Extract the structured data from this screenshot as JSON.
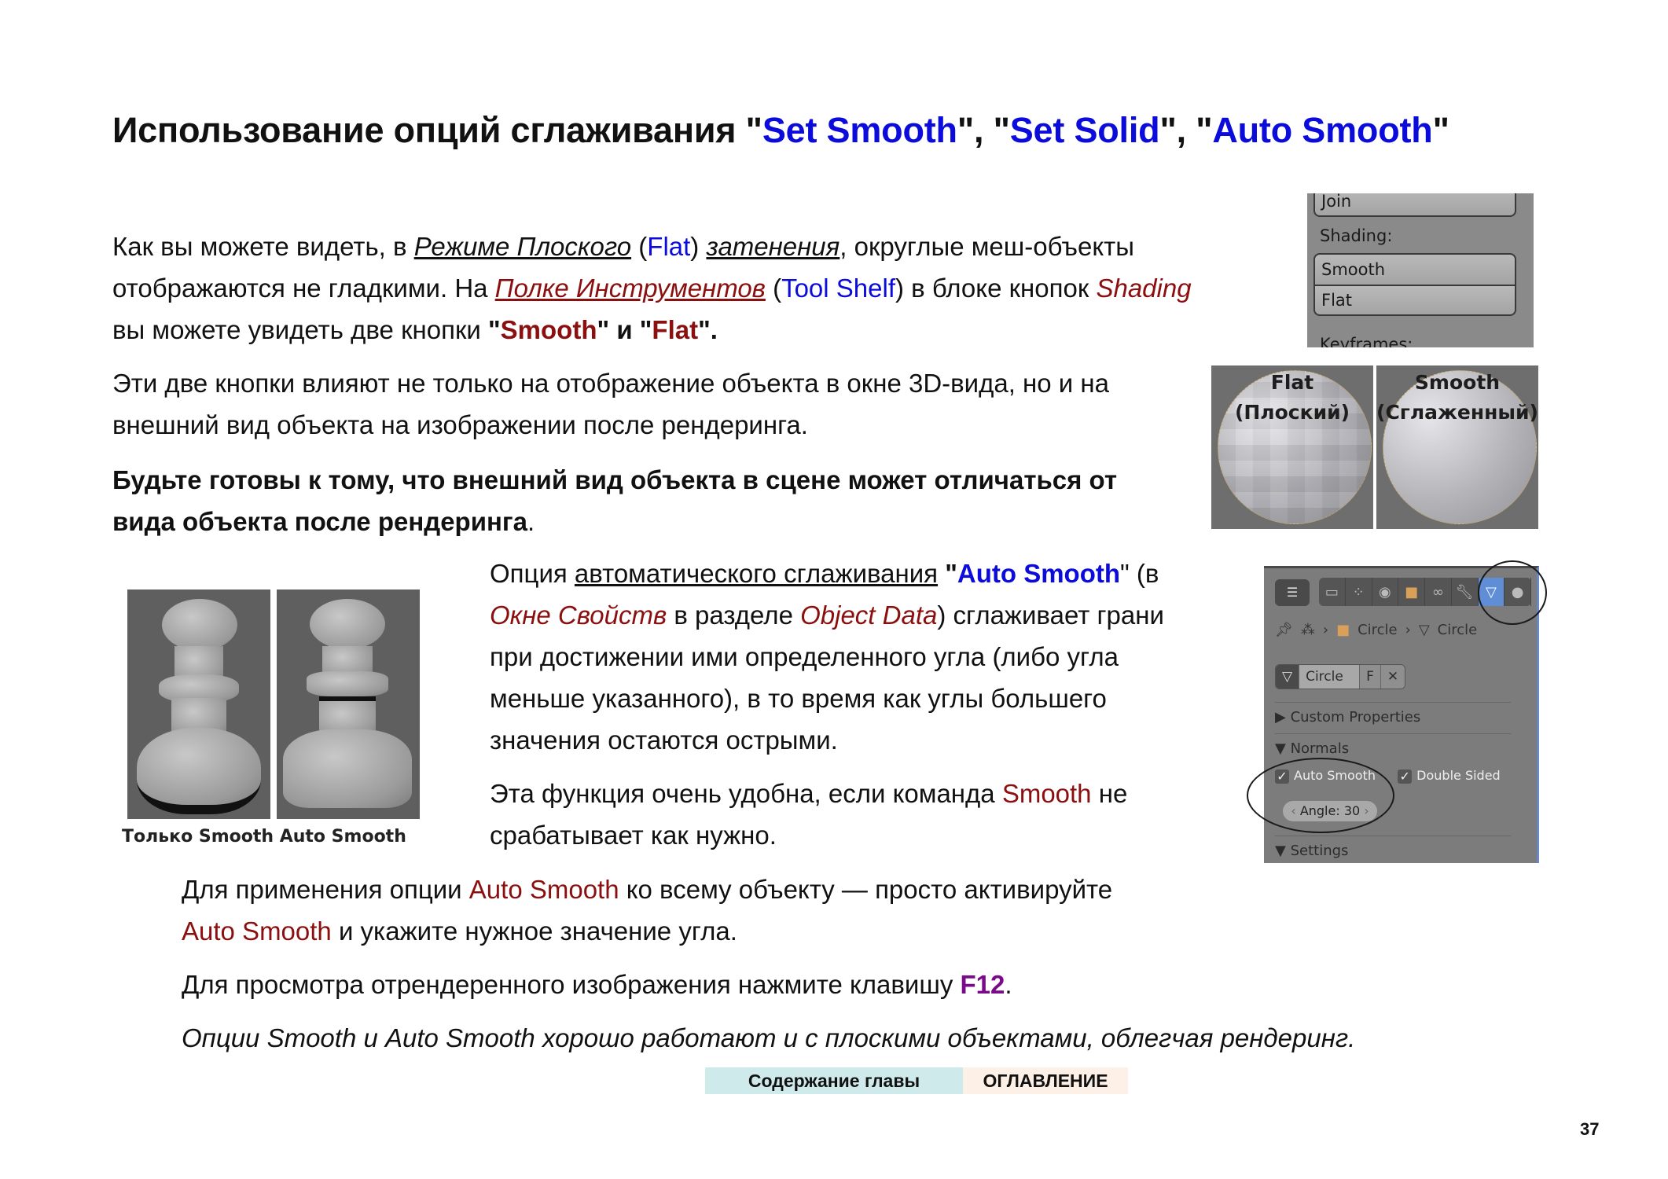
{
  "title": {
    "prefix": "Использование опций сглаживания \"",
    "opt1": "Set Smooth",
    "sep1": "\", \"",
    "opt2": "Set Solid",
    "sep2": "\", \"",
    "opt3": "Auto Smooth",
    "suffix": "\""
  },
  "para1": {
    "l1_a": "Как вы можете видеть, в ",
    "l1_link1": "Режиме Плоского",
    "l1_b": " (",
    "l1_flat": "Flat",
    "l1_c": ") ",
    "l1_link2": "затенения",
    "l1_d": ", округлые меш-объекты",
    "l2_a": "отображаются не гладкими. На ",
    "l2_link": "Полке Инструментов",
    "l2_b": " (",
    "l2_toolshelf": "Tool Shelf",
    "l2_c": ") в блоке кнопок ",
    "l2_shading": "Shading",
    "l3_a": "вы можете увидеть две кнопки ",
    "l3_q1": "\"",
    "l3_smooth": "Smooth",
    "l3_mid": "\" и \"",
    "l3_flat": "Flat",
    "l3_end": "\"."
  },
  "para2": {
    "l1": "Эти две кнопки влияют не только на отображение объекта в окне 3D-вида, но и на",
    "l2": "внешний вид объекта на изображении после рендеринга."
  },
  "para3": {
    "l1": "Будьте готовы к тому, что внешний вид объекта в сцене может отличаться от",
    "l2": "вида объекта после рендеринга",
    "l2_end": "."
  },
  "para4": {
    "l1_a": "Опция ",
    "l1_link": "автоматического сглаживания",
    "l1_b": " \"",
    "l1_auto": "Auto Smooth",
    "l1_c": "\" (в",
    "l2_props": "Окне Свойств",
    "l2_a": " в разделе ",
    "l2_objdata": "Object Data",
    "l2_b": ") сглаживает грани",
    "l3": "при достижении ими определенного угла (либо угла",
    "l4": "меньше указанного), в то время как углы большего",
    "l5": "значения остаются острыми."
  },
  "para5": {
    "l1_a": "Эта функция очень удобна, если команда ",
    "l1_smooth": "Smooth",
    "l1_b": " не",
    "l2": "срабатывает как нужно."
  },
  "para6": {
    "l1_a": "Для применения опции ",
    "l1_auto": "Auto Smooth",
    "l1_b": " ко всему объекту — просто активируйте",
    "l2_auto": "Auto Smooth",
    "l2_b": " и укажите нужное значение угла."
  },
  "para7": {
    "text": "Для просмотра отрендеренного изображения нажмите клавишу ",
    "key": "F12",
    "end": "."
  },
  "para8": {
    "text": "Опции Smooth и Auto Smooth хорошо работают и с плоскими объектами, облегчая рендеринг."
  },
  "shading_panel": {
    "join_label": "Join",
    "section_label": "Shading:",
    "smooth_button": "Smooth",
    "flat_button": "Flat",
    "keyframes_label": "Keyframes:"
  },
  "spheres": {
    "flat_title": "Flat",
    "flat_subtitle": "(Плоский)",
    "smooth_title": "Smooth",
    "smooth_subtitle": "(Сглаженный)"
  },
  "pawns": {
    "caption_left": "Только Smooth",
    "caption_right": "Auto Smooth"
  },
  "properties_panel": {
    "breadcrumb": [
      "Circle",
      "Circle"
    ],
    "mesh_name": "Circle",
    "fake_user": "F",
    "custom_properties": "Custom Properties",
    "normals": "Normals",
    "auto_smooth_label": "Auto Smooth",
    "auto_smooth_checked": true,
    "double_sided_label": "Double Sided",
    "double_sided_checked": true,
    "angle_label": "Angle: 30",
    "settings": "Settings"
  },
  "footer": {
    "chapter_contents": "Содержание главы",
    "table_of_contents": "ОГЛАВЛЕНИЕ",
    "page_number": "37"
  },
  "colors": {
    "blue": "#0b0bdc",
    "dark_red": "#8b0f0f",
    "purple": "#7a0a8a"
  }
}
